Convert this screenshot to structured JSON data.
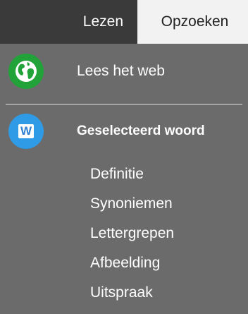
{
  "tabs": {
    "read_label": "Lezen",
    "lookup_label": "Opzoeken"
  },
  "menu": {
    "web_item": {
      "label": "Lees het web",
      "icon": "globe-icon"
    },
    "word_item": {
      "label": "Geselecteerd woord",
      "icon": "word-icon",
      "icon_letter": "W"
    },
    "sub_items": [
      {
        "label": "Definitie"
      },
      {
        "label": "Synoniemen"
      },
      {
        "label": "Lettergrepen"
      },
      {
        "label": "Afbeelding"
      },
      {
        "label": "Uitspraak"
      }
    ]
  },
  "colors": {
    "panel_bg": "#6b6b6b",
    "tab_dark": "#3a3a3a",
    "tab_active": "#f2f2f2",
    "globe_green": "#21a33a",
    "word_blue": "#2f9be6"
  }
}
